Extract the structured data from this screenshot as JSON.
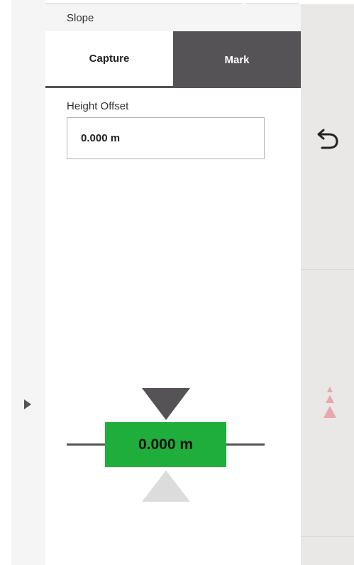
{
  "panel": {
    "title": "Slope",
    "tabs": [
      {
        "label": "Capture",
        "active": true
      },
      {
        "label": "Mark",
        "active": false
      }
    ],
    "height_offset": {
      "label": "Height Offset",
      "value": "0.000 m"
    }
  },
  "grade_indicator": {
    "value": "0.000 m",
    "status_color": "#1fad3b",
    "up_arrow_color": "#dcdcdc",
    "down_arrow_color": "#555356"
  },
  "right_toolbar": {
    "undo_icon": "undo-icon",
    "marker_icon": "stacked-triangles-icon",
    "marker_color": "#e7a7ad"
  },
  "left_rail": {
    "expand_icon": "chevron-right-icon"
  }
}
